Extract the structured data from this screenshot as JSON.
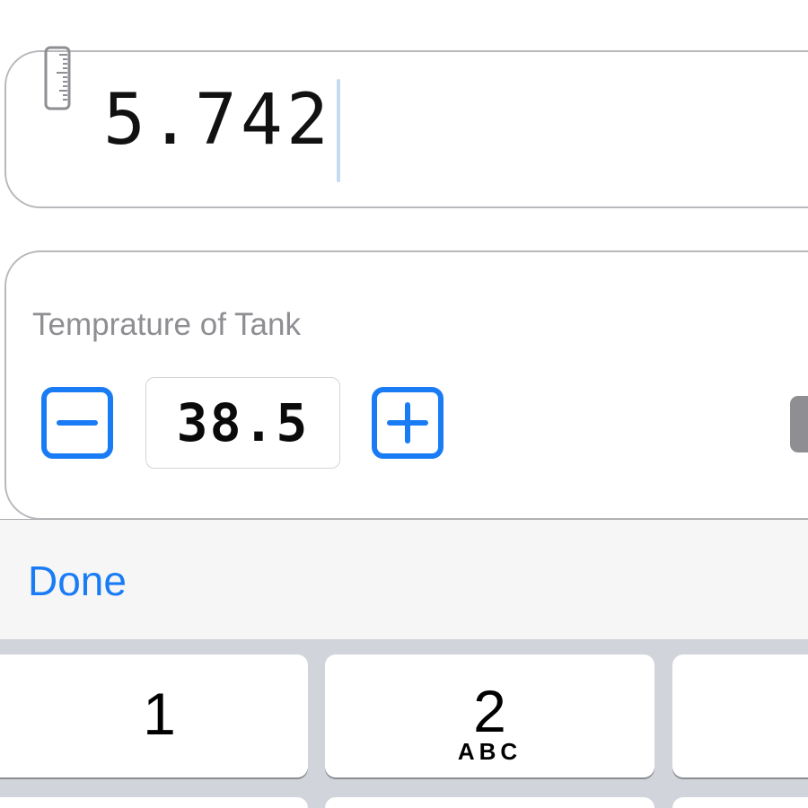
{
  "measurement_field": {
    "icon": "ruler-icon",
    "value": "5.742"
  },
  "temperature": {
    "title": "Temprature of Tank",
    "value": "38.5",
    "decrement_icon": "minus-square-icon",
    "increment_icon": "plus-square-icon"
  },
  "accessory_bar": {
    "done_label": "Done"
  },
  "keypad": {
    "keys": [
      {
        "digit": "1",
        "letters": ""
      },
      {
        "digit": "2",
        "letters": "ABC"
      }
    ]
  },
  "colors": {
    "accent": "#1a7cf5",
    "caret": "#c5daf3",
    "secondary_text": "#8e8e93",
    "keypad_background": "#d1d4da",
    "accessory_background": "#f6f6f6"
  }
}
